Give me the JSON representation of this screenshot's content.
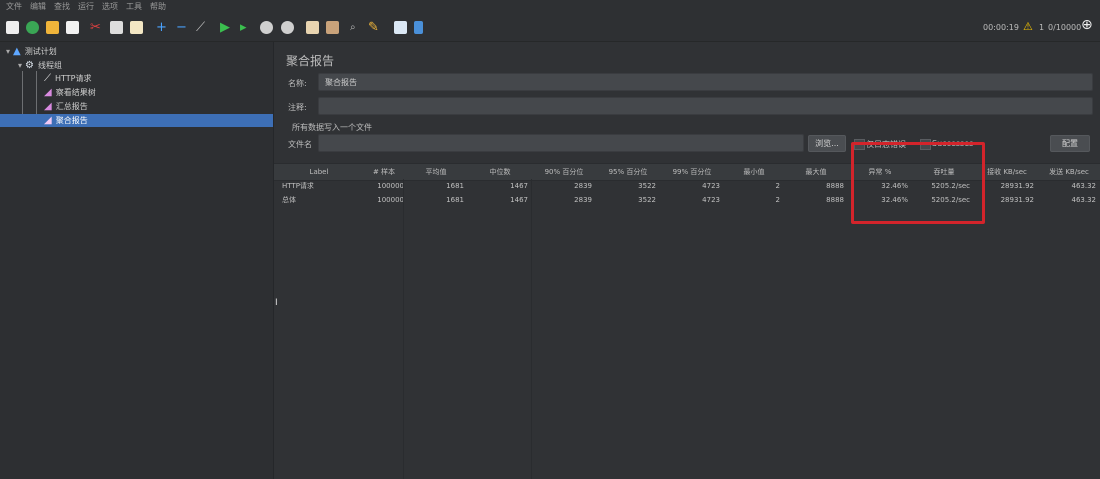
{
  "menu": [
    "文件",
    "编辑",
    "查找",
    "运行",
    "选项",
    "工具",
    "帮助"
  ],
  "toolbar": {
    "timer": "00:00:19",
    "warn_count": "1",
    "thread_counts": "0/10000"
  },
  "tree": {
    "test_plan": "测试计划",
    "thread_group": "线程组",
    "http_request": "HTTP请求",
    "view_results_tree": "察看结果树",
    "summary_report": "汇总报告",
    "aggregate_report": "聚合报告"
  },
  "main": {
    "title": "聚合报告",
    "name_label": "名称:",
    "name_value": "聚合报告",
    "comment_label": "注释:",
    "write_all_label": "所有数据写入一个文件",
    "filename_label": "文件名",
    "browse_button": "浏览...",
    "log_errors_label": "仅日志错误",
    "successes_label": "Successes",
    "configure_button": "配置"
  },
  "table": {
    "headers": [
      "Label",
      "# 样本",
      "平均值",
      "中位数",
      "90% 百分位",
      "95% 百分位",
      "99% 百分位",
      "最小值",
      "最大值",
      "异常 %",
      "吞吐量",
      "接收 KB/sec",
      "发送 KB/sec"
    ],
    "rows": [
      [
        "HTTP请求",
        "100000",
        "1681",
        "1467",
        "2839",
        "3522",
        "4723",
        "2",
        "8888",
        "32.46%",
        "5205.2/sec",
        "28931.92",
        "463.32"
      ],
      [
        "总体",
        "100000",
        "1681",
        "1467",
        "2839",
        "3522",
        "4723",
        "2",
        "8888",
        "32.46%",
        "5205.2/sec",
        "28931.92",
        "463.32"
      ]
    ]
  },
  "colors": {
    "highlight": "#d3242b",
    "selection": "#3d6fb6"
  }
}
